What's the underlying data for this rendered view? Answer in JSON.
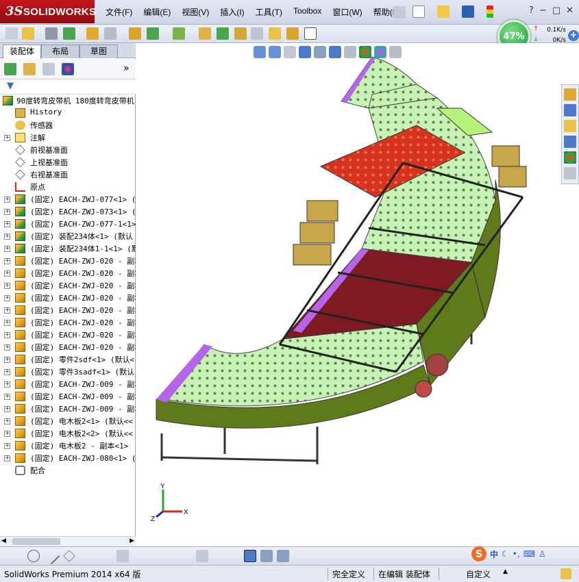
{
  "app": {
    "logo_prefix": "3S",
    "logo_name": "SOLIDWORKS"
  },
  "menu": [
    "文件(F)",
    "编辑(E)",
    "视图(V)",
    "插入(I)",
    "工具(T)",
    "Toolbox",
    "窗口(W)",
    "帮助(H)"
  ],
  "window_buttons": {
    "minimize": "−",
    "restore": "□",
    "close": "✕",
    "help": "?"
  },
  "gauge": {
    "percent": "47%",
    "upload": "0.1K/s",
    "download": "0K/s",
    "plus": "+"
  },
  "panel": {
    "tabs": [
      "装配体",
      "布局",
      "草图"
    ],
    "root": "90度转弯皮带机 180度转弯皮带机",
    "items": [
      {
        "label": "History",
        "icon": "history-icon",
        "expand": ""
      },
      {
        "label": "传感器",
        "icon": "sensor-icon",
        "expand": ""
      },
      {
        "label": "注解",
        "icon": "annotation-icon",
        "expand": "+"
      },
      {
        "label": "前视基准面",
        "icon": "plane-icon",
        "expand": ""
      },
      {
        "label": "上视基准面",
        "icon": "plane-icon",
        "expand": ""
      },
      {
        "label": "右视基准面",
        "icon": "plane-icon",
        "expand": ""
      },
      {
        "label": "原点",
        "icon": "origin-icon",
        "expand": ""
      },
      {
        "label": "(固定) EACH-ZWJ-077<1> (默",
        "icon": "asm",
        "expand": "+"
      },
      {
        "label": "(固定) EACH-ZWJ-073<1> (默",
        "icon": "asm",
        "expand": "+"
      },
      {
        "label": "(固定) EACH-ZWJ-077-1<1>",
        "icon": "asm",
        "expand": "+"
      },
      {
        "label": "(固定) 装配234体<1> (默认",
        "icon": "asm",
        "expand": "+"
      },
      {
        "label": "(固定) 装配234体1-1<1> (默",
        "icon": "asm",
        "expand": "+"
      },
      {
        "label": "(固定) EACH-ZWJ-020 - 副本",
        "icon": "part",
        "expand": "+"
      },
      {
        "label": "(固定) EACH-ZWJ-020 - 副本",
        "icon": "part",
        "expand": "+"
      },
      {
        "label": "(固定) EACH-ZWJ-020 - 副本",
        "icon": "part",
        "expand": "+"
      },
      {
        "label": "(固定) EACH-ZWJ-020 - 副本",
        "icon": "part",
        "expand": "+"
      },
      {
        "label": "(固定) EACH-ZWJ-020 - 副本",
        "icon": "part",
        "expand": "+"
      },
      {
        "label": "(固定) EACH-ZWJ-020 - 副本",
        "icon": "part",
        "expand": "+"
      },
      {
        "label": "(固定) EACH-ZWJ-020 - 副本",
        "icon": "part",
        "expand": "+"
      },
      {
        "label": "(固定) EACH-ZWJ-020 - 副本",
        "icon": "part",
        "expand": "+"
      },
      {
        "label": "(固定) 零件2sdf<1> (默认<",
        "icon": "part",
        "expand": "+"
      },
      {
        "label": "(固定) 零件3sadf<1> (默认",
        "icon": "part",
        "expand": "+"
      },
      {
        "label": "(固定) EACH-ZWJ-009 - 副本",
        "icon": "part",
        "expand": "+"
      },
      {
        "label": "(固定) EACH-ZWJ-009 - 副本",
        "icon": "part",
        "expand": "+"
      },
      {
        "label": "(固定) EACH-ZWJ-009 - 副本",
        "icon": "part",
        "expand": "+"
      },
      {
        "label": "(固定) 电木板2<1> (默认<<",
        "icon": "part",
        "expand": "+"
      },
      {
        "label": "(固定) 电木板2<2> (默认<<",
        "icon": "part",
        "expand": "+"
      },
      {
        "label": "(固定) 电木板2 - 副本<1>",
        "icon": "part",
        "expand": "+"
      },
      {
        "label": "(固定) EACH-ZWJ-080<1> (默",
        "icon": "part",
        "expand": "+"
      },
      {
        "label": "配合",
        "icon": "mates-icon",
        "expand": ""
      }
    ]
  },
  "triad": {
    "x": "X",
    "y": "Y",
    "z": "Z"
  },
  "ime": {
    "logo": "S",
    "mode": "中"
  },
  "status": {
    "version": "SolidWorks Premium 2014 x64 版",
    "definition": "完全定义",
    "editing": "在编辑 装配体",
    "custom": "自定义"
  },
  "colors": {
    "accent": "#c4161c",
    "belt_dots": "#b9f0a8",
    "frame_green": "#5f7a1a",
    "red_panel": "#d42a1a"
  }
}
